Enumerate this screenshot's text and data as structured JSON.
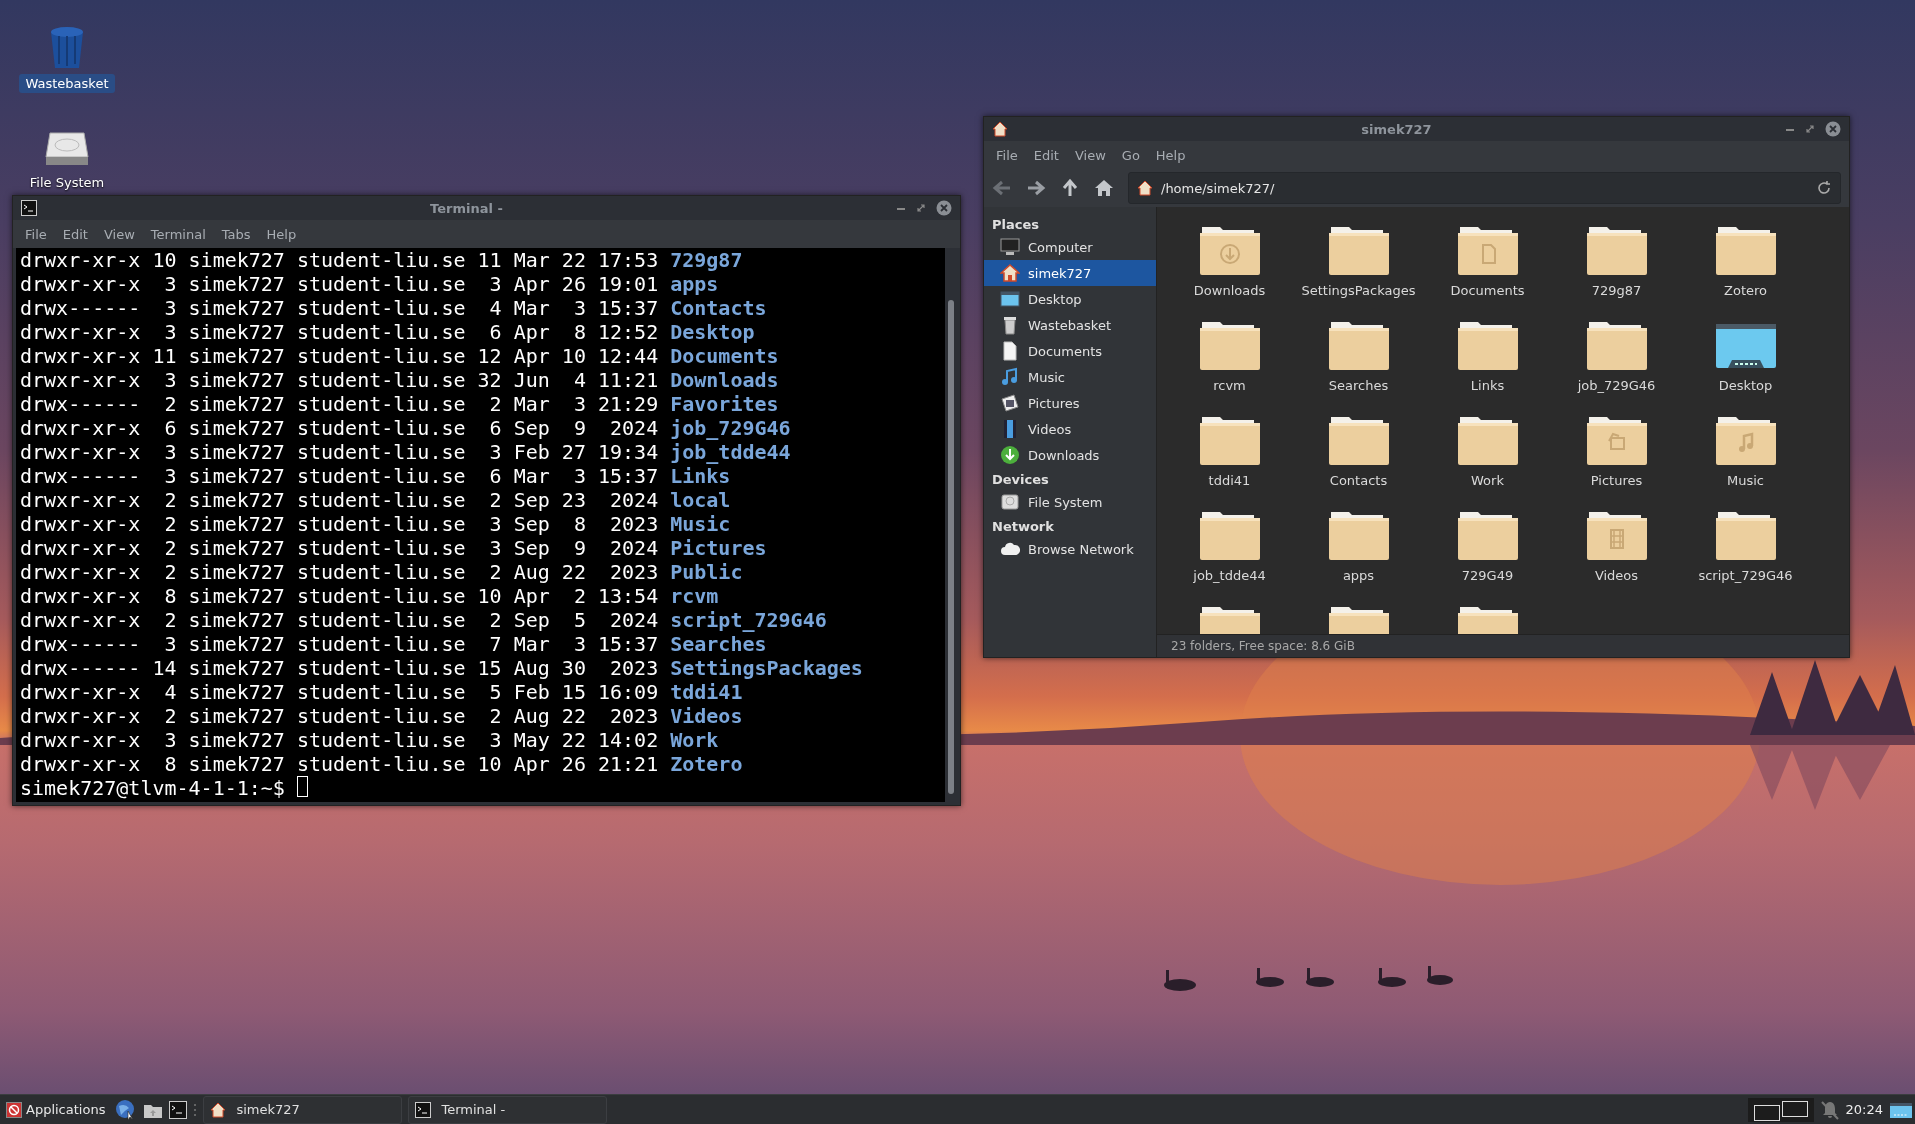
{
  "desktop": {
    "icons": [
      {
        "label": "Wastebasket",
        "kind": "trash",
        "selected": true
      },
      {
        "label": "File System",
        "kind": "drive",
        "selected": false
      }
    ]
  },
  "terminal": {
    "title": "Terminal -",
    "menu": [
      "File",
      "Edit",
      "View",
      "Terminal",
      "Tabs",
      "Help"
    ],
    "lines": [
      {
        "info": "drwxr-xr-x 10 simek727 student-liu.se 11 Mar 22 17:53",
        "name": "729g87"
      },
      {
        "info": "drwxr-xr-x  3 simek727 student-liu.se  3 Apr 26 19:01",
        "name": "apps"
      },
      {
        "info": "drwx------  3 simek727 student-liu.se  4 Mar  3 15:37",
        "name": "Contacts"
      },
      {
        "info": "drwxr-xr-x  3 simek727 student-liu.se  6 Apr  8 12:52",
        "name": "Desktop"
      },
      {
        "info": "drwxr-xr-x 11 simek727 student-liu.se 12 Apr 10 12:44",
        "name": "Documents"
      },
      {
        "info": "drwxr-xr-x  3 simek727 student-liu.se 32 Jun  4 11:21",
        "name": "Downloads"
      },
      {
        "info": "drwx------  2 simek727 student-liu.se  2 Mar  3 21:29",
        "name": "Favorites"
      },
      {
        "info": "drwxr-xr-x  6 simek727 student-liu.se  6 Sep  9  2024",
        "name": "job_729G46"
      },
      {
        "info": "drwxr-xr-x  3 simek727 student-liu.se  3 Feb 27 19:34",
        "name": "job_tdde44"
      },
      {
        "info": "drwx------  3 simek727 student-liu.se  6 Mar  3 15:37",
        "name": "Links"
      },
      {
        "info": "drwxr-xr-x  2 simek727 student-liu.se  2 Sep 23  2024",
        "name": "local"
      },
      {
        "info": "drwxr-xr-x  2 simek727 student-liu.se  3 Sep  8  2023",
        "name": "Music"
      },
      {
        "info": "drwxr-xr-x  2 simek727 student-liu.se  3 Sep  9  2024",
        "name": "Pictures"
      },
      {
        "info": "drwxr-xr-x  2 simek727 student-liu.se  2 Aug 22  2023",
        "name": "Public"
      },
      {
        "info": "drwxr-xr-x  8 simek727 student-liu.se 10 Apr  2 13:54",
        "name": "rcvm"
      },
      {
        "info": "drwxr-xr-x  2 simek727 student-liu.se  2 Sep  5  2024",
        "name": "script_729G46"
      },
      {
        "info": "drwx------  3 simek727 student-liu.se  7 Mar  3 15:37",
        "name": "Searches"
      },
      {
        "info": "drwx------ 14 simek727 student-liu.se 15 Aug 30  2023",
        "name": "SettingsPackages"
      },
      {
        "info": "drwxr-xr-x  4 simek727 student-liu.se  5 Feb 15 16:09",
        "name": "tddi41"
      },
      {
        "info": "drwxr-xr-x  2 simek727 student-liu.se  2 Aug 22  2023",
        "name": "Videos"
      },
      {
        "info": "drwxr-xr-x  3 simek727 student-liu.se  3 May 22 14:02",
        "name": "Work"
      },
      {
        "info": "drwxr-xr-x  8 simek727 student-liu.se 10 Apr 26 21:21",
        "name": "Zotero"
      }
    ],
    "prompt": "simek727@tlvm-4-1-1:~$"
  },
  "file_manager": {
    "title": "simek727",
    "menu": [
      "File",
      "Edit",
      "View",
      "Go",
      "Help"
    ],
    "location": "/home/simek727/",
    "sidebar": [
      {
        "heading": "Places",
        "items": [
          {
            "label": "Computer",
            "kind": "computer",
            "selected": false
          },
          {
            "label": "simek727",
            "kind": "home",
            "selected": true
          },
          {
            "label": "Desktop",
            "kind": "desktop",
            "selected": false
          },
          {
            "label": "Wastebasket",
            "kind": "trash",
            "selected": false
          },
          {
            "label": "Documents",
            "kind": "document",
            "selected": false
          },
          {
            "label": "Music",
            "kind": "music",
            "selected": false
          },
          {
            "label": "Pictures",
            "kind": "pictures",
            "selected": false
          },
          {
            "label": "Videos",
            "kind": "videos",
            "selected": false
          },
          {
            "label": "Downloads",
            "kind": "downloads",
            "selected": false
          }
        ]
      },
      {
        "heading": "Devices",
        "items": [
          {
            "label": "File System",
            "kind": "drive",
            "selected": false
          }
        ]
      },
      {
        "heading": "Network",
        "items": [
          {
            "label": "Browse Network",
            "kind": "network",
            "selected": false
          }
        ]
      }
    ],
    "items": [
      {
        "label": "Downloads",
        "kind": "downloads"
      },
      {
        "label": "SettingsPackages",
        "kind": "folder"
      },
      {
        "label": "Documents",
        "kind": "documents"
      },
      {
        "label": "729g87",
        "kind": "folder"
      },
      {
        "label": "Zotero",
        "kind": "folder"
      },
      {
        "label": "rcvm",
        "kind": "folder"
      },
      {
        "label": "Searches",
        "kind": "folder"
      },
      {
        "label": "Links",
        "kind": "folder"
      },
      {
        "label": "job_729G46",
        "kind": "folder"
      },
      {
        "label": "Desktop",
        "kind": "desktop"
      },
      {
        "label": "tddi41",
        "kind": "folder"
      },
      {
        "label": "Contacts",
        "kind": "folder"
      },
      {
        "label": "Work",
        "kind": "folder"
      },
      {
        "label": "Pictures",
        "kind": "pictures"
      },
      {
        "label": "Music",
        "kind": "music"
      },
      {
        "label": "job_tdde44",
        "kind": "folder"
      },
      {
        "label": "apps",
        "kind": "folder"
      },
      {
        "label": "729G49",
        "kind": "folder"
      },
      {
        "label": "Videos",
        "kind": "videos"
      },
      {
        "label": "script_729G46",
        "kind": "folder"
      },
      {
        "kind": "folder"
      },
      {
        "kind": "folder"
      },
      {
        "kind": "folder"
      }
    ],
    "status_bar": "23 folders, Free space: 8.6 GiB"
  },
  "taskbar": {
    "menu_button": "Applications",
    "tasks": [
      {
        "label": "simek727",
        "kind": "file-manager"
      },
      {
        "label": "Terminal -",
        "kind": "terminal"
      }
    ],
    "clock": "20:24"
  }
}
